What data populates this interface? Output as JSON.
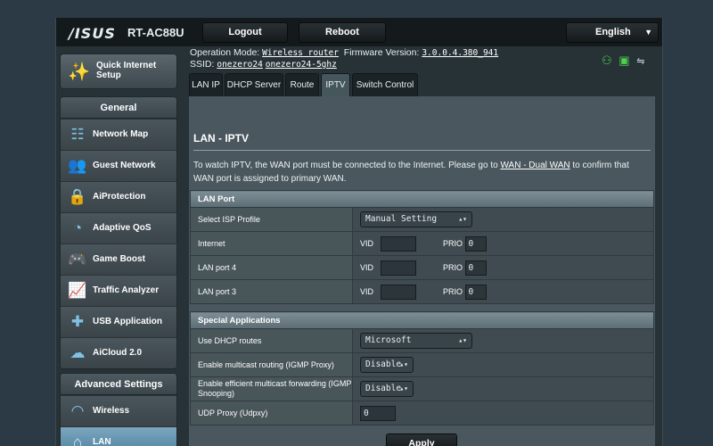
{
  "header": {
    "logo": "/ISUS",
    "model": "RT-AC88U",
    "logout_label": "Logout",
    "reboot_label": "Reboot",
    "language": "English"
  },
  "info": {
    "operation_mode_label": "Operation Mode:",
    "operation_mode_value": "Wireless router",
    "firmware_label": "Firmware Version:",
    "firmware_value": "3.0.0.4.380_941",
    "ssid_label": "SSID:",
    "ssid_1": "onezero24",
    "ssid_2": "onezero24-5ghz"
  },
  "sidebar": {
    "quick_label": "Quick Internet Setup",
    "general_heading": "General",
    "general_items": [
      {
        "label": "Network Map",
        "icon": "network-map-icon"
      },
      {
        "label": "Guest Network",
        "icon": "guest-network-icon"
      },
      {
        "label": "AiProtection",
        "icon": "lock-icon"
      },
      {
        "label": "Adaptive QoS",
        "icon": "gauge-icon"
      },
      {
        "label": "Game Boost",
        "icon": "gamepad-icon"
      },
      {
        "label": "Traffic Analyzer",
        "icon": "chart-icon"
      },
      {
        "label": "USB Application",
        "icon": "puzzle-icon"
      },
      {
        "label": "AiCloud 2.0",
        "icon": "cloud-icon"
      }
    ],
    "advanced_heading": "Advanced Settings",
    "advanced_items": [
      {
        "label": "Wireless",
        "icon": "wifi-icon"
      },
      {
        "label": "LAN",
        "icon": "home-icon"
      }
    ]
  },
  "tabs": [
    "LAN IP",
    "DHCP Server",
    "Route",
    "IPTV",
    "Switch Control"
  ],
  "active_tab": "IPTV",
  "main": {
    "title": "LAN - IPTV",
    "description_1": "To watch IPTV, the WAN port must be connected to the Internet. Please go to ",
    "description_link": "WAN - Dual WAN",
    "description_2": " to confirm that WAN port is assigned to primary WAN.",
    "lan_port": {
      "heading": "LAN Port",
      "isp_profile_label": "Select ISP Profile",
      "isp_profile_value": "Manual Setting",
      "vid_label": "VID",
      "prio_label": "PRIO",
      "rows": [
        {
          "label": "Internet",
          "vid": "",
          "prio": "0"
        },
        {
          "label": "LAN port 4",
          "vid": "",
          "prio": "0"
        },
        {
          "label": "LAN port 3",
          "vid": "",
          "prio": "0"
        }
      ]
    },
    "special_apps": {
      "heading": "Special Applications",
      "dhcp_routes_label": "Use DHCP routes",
      "dhcp_routes_value": "Microsoft",
      "multicast_routing_label": "Enable multicast routing (IGMP Proxy)",
      "multicast_routing_value": "Disable",
      "multicast_forwarding_label": "Enable efficient multicast forwarding (IGMP Snooping)",
      "multicast_forwarding_value": "Disable",
      "udp_proxy_label": "UDP Proxy (Udpxy)",
      "udp_proxy_value": "0"
    },
    "apply_label": "Apply"
  },
  "colors": {
    "accent": "#7fc2e6",
    "status_green": "#4cd24c",
    "active_nav": "#5f8fac"
  }
}
